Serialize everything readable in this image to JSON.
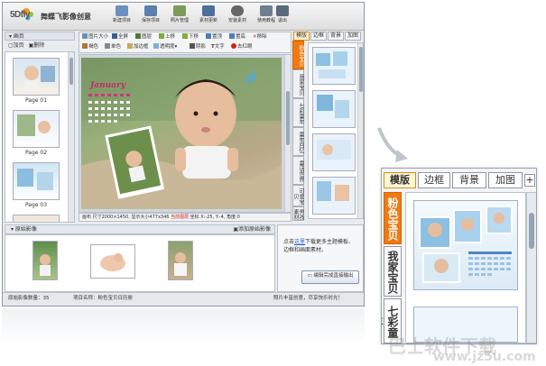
{
  "app": {
    "logo": "5Dfly",
    "title": "舞蝶飞影像创意"
  },
  "toolbar": {
    "buttons": [
      {
        "label": "新建项目",
        "icon": "new-project-icon"
      },
      {
        "label": "保存项目",
        "icon": "save-icon"
      },
      {
        "label": "照片管理",
        "icon": "photo-manage-icon"
      },
      {
        "label": "素材更新",
        "icon": "material-update-icon"
      },
      {
        "label": "安装素材",
        "icon": "install-material-icon"
      },
      {
        "label": "使用教程",
        "icon": "tutorial-icon"
      },
      {
        "label": "退出",
        "icon": "exit-icon"
      }
    ]
  },
  "pages_panel": {
    "header": "画页",
    "add_label": "加页",
    "delete_label": "删除",
    "pages": [
      "Page 01",
      "Page 02",
      "Page 03"
    ]
  },
  "edit_tools": {
    "row1": [
      "图片大小",
      "全屏",
      "图层",
      "上移",
      "下移",
      "置顶",
      "置底",
      "移除"
    ],
    "row2": [
      "褐色",
      "单色",
      "加边框",
      "透明度",
      "阴影",
      "文字",
      "去红眼"
    ]
  },
  "canvas": {
    "calendar_title": "January",
    "status_text": "画布 尺寸2000×1450, 显示大小477x346",
    "status_tag": "当前图层",
    "status_coords": "坐标 X:-25, Y:-4, 角度:0"
  },
  "right_panel": {
    "tabs": [
      "模版",
      "边框",
      "背景",
      "加图"
    ],
    "plus": "+",
    "categories": [
      "粉色宝贝",
      "我家宝贝",
      "七彩童年",
      "童年回忆",
      "童话世界",
      "可爱宝贝",
      "男孩素材"
    ]
  },
  "bottom_panel": {
    "header": "原始影像",
    "add_label": "添加原始影像",
    "help_prefix": "点击",
    "help_link": "这里",
    "help_suffix": "下载更多主题模板、边框和画面素材。",
    "edit_button": "编辑完成直接输出"
  },
  "statusbar": {
    "image_count": "原始影像数量：35",
    "project_name": "项目名称：粉色宝贝日历册",
    "tip": "照片丰富创意，尽享快乐时光！"
  },
  "zoom": {
    "tabs": [
      "模版",
      "边框",
      "背景",
      "加图"
    ],
    "plus": "+",
    "categories": [
      "粉色宝贝",
      "我家宝贝",
      "七彩童年"
    ]
  },
  "watermark": {
    "text": "巴士软件下载",
    "url": "www.jz5u.com"
  },
  "colors": {
    "accent_orange": "#f07a10",
    "panel_bg": "#e9ecef",
    "link_blue": "#1b5fd0",
    "status_red": "#c81e1e"
  }
}
